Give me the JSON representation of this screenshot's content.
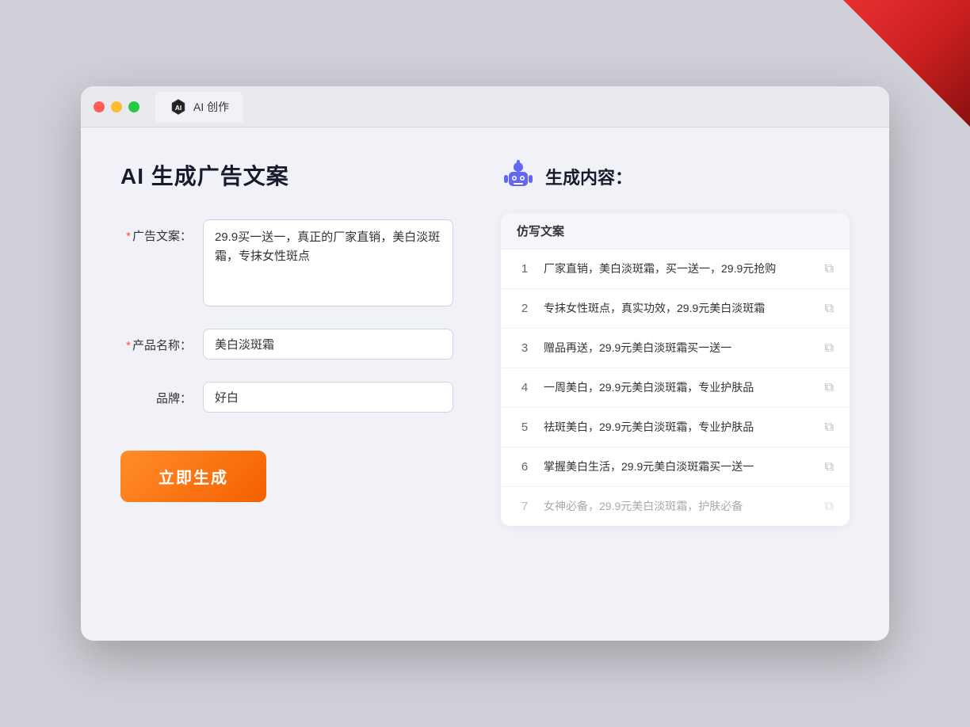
{
  "window": {
    "tab_label": "AI 创作"
  },
  "left_panel": {
    "title": "AI 生成广告文案",
    "fields": [
      {
        "label": "广告文案：",
        "required": true,
        "type": "textarea",
        "value": "29.9买一送一，真正的厂家直销，美白淡斑霜，专抹女性斑点",
        "name": "ad-copy-input"
      },
      {
        "label": "产品名称：",
        "required": true,
        "type": "input",
        "value": "美白淡斑霜",
        "name": "product-name-input"
      },
      {
        "label": "品牌：",
        "required": false,
        "type": "input",
        "value": "好白",
        "name": "brand-input"
      }
    ],
    "button_label": "立即生成"
  },
  "right_panel": {
    "title": "生成内容：",
    "table_header": "仿写文案",
    "results": [
      {
        "id": 1,
        "text": "厂家直销，美白淡斑霜，买一送一，29.9元抢购",
        "dimmed": false
      },
      {
        "id": 2,
        "text": "专抹女性斑点，真实功效，29.9元美白淡斑霜",
        "dimmed": false
      },
      {
        "id": 3,
        "text": "赠品再送，29.9元美白淡斑霜买一送一",
        "dimmed": false
      },
      {
        "id": 4,
        "text": "一周美白，29.9元美白淡斑霜，专业护肤品",
        "dimmed": false
      },
      {
        "id": 5,
        "text": "祛斑美白，29.9元美白淡斑霜，专业护肤品",
        "dimmed": false
      },
      {
        "id": 6,
        "text": "掌握美白生活，29.9元美白淡斑霜买一送一",
        "dimmed": false
      },
      {
        "id": 7,
        "text": "女神必备，29.9元美白淡斑霜，护肤必备",
        "dimmed": true
      }
    ]
  }
}
